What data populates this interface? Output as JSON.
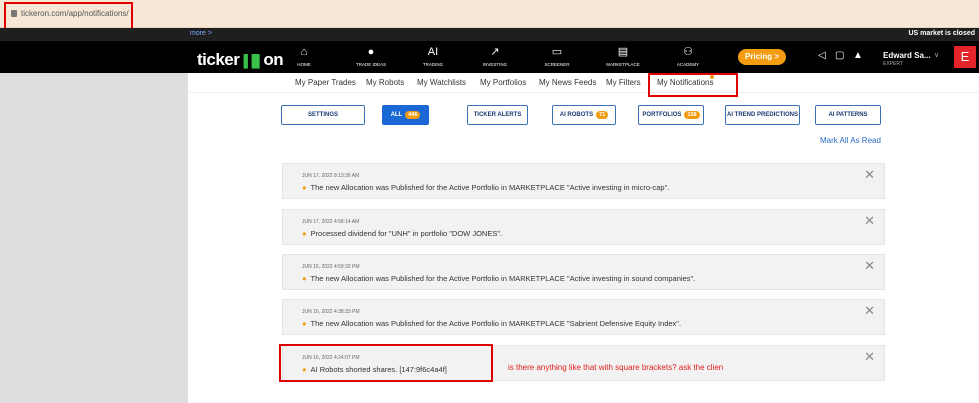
{
  "browser": {
    "url": "tickeron.com/app/notifications/"
  },
  "topbar": {
    "more": "more >",
    "market_status": "US market is closed"
  },
  "brand": {
    "logo_text": "ticker",
    "logo_bars": "▐▐▌",
    "logo_suffix": "on"
  },
  "nav": {
    "items": [
      {
        "label": "HOME",
        "icon": "⌂"
      },
      {
        "label": "TRADE IDEAS",
        "icon": "●"
      },
      {
        "label": "TRADING",
        "icon": "AI"
      },
      {
        "label": "INVESTING",
        "icon": "↗"
      },
      {
        "label": "SCREENER",
        "icon": "▭"
      },
      {
        "label": "MARKETPLACE",
        "icon": "▤"
      },
      {
        "label": "ACADEMY",
        "icon": "⚇"
      }
    ],
    "pricing": "Pricing >",
    "icons": [
      "megaphone-icon",
      "chat-icon",
      "bell-icon"
    ],
    "user_name": "Edward Sa...",
    "user_role": "EXPERT",
    "avatar_letter": "E"
  },
  "subnav": {
    "items": [
      "My Paper Trades",
      "My Robots",
      "My Watchlists",
      "My Portfolios",
      "My News Feeds",
      "My Filters",
      "My Notifications"
    ]
  },
  "filters": {
    "settings": "SETTINGS",
    "all": "ALL",
    "all_count": "446",
    "ticker_alerts": "TICKER ALERTS",
    "ai_robots": "AI ROBOTS",
    "ai_robots_count": "71",
    "portfolios": "PORTFOLIOS",
    "portfolios_count": "158",
    "ai_trend": "AI TREND PREDICTIONS",
    "ai_patterns": "AI PATTERNS"
  },
  "mark_all": "Mark All As Read",
  "notifications": [
    {
      "ts": "JUN 17, 2022 8:13:36 AM",
      "msg": "The new Allocation was Published for the Active Portfolio in MARKETPLACE \"Active investing in micro-cap\"."
    },
    {
      "ts": "JUN 17, 2022 4:58:14 AM",
      "msg": "Processed dividend for \"UNH\" in portfolio \"DOW JONES\"."
    },
    {
      "ts": "JUN 16, 2022 4:59:32 PM",
      "msg": "The new Allocation was Published for the Active Portfolio in MARKETPLACE \"Active investing in sound companies\"."
    },
    {
      "ts": "JUN 16, 2022 4:38:33 PM",
      "msg": "The new Allocation was Published for the Active Portfolio in MARKETPLACE \"Sabrient Defensive Equity Index\"."
    },
    {
      "ts": "JUN 16, 2022 4:24:07 PM",
      "msg": "AI Robots shorted shares. [147:9f6c4a4f]"
    }
  ],
  "annotation": "is there anything like that with square brackets? ask the clien",
  "colors": {
    "accent": "#f39c12",
    "primary": "#1a68d6",
    "highlight": "#e00000"
  }
}
